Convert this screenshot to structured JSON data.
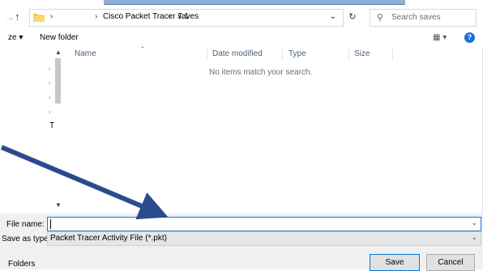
{
  "address_bar": {
    "path": [
      "Cisco Packet Tracer 7.1",
      "saves"
    ],
    "separator": "›"
  },
  "search": {
    "placeholder": "Search saves"
  },
  "toolbar": {
    "organize_label": "ze ▾",
    "new_folder_label": "New folder",
    "view_label": "▦ ▾",
    "help_label": "?"
  },
  "columns": [
    "Name",
    "Date modified",
    "Type",
    "Size"
  ],
  "file_list": {
    "empty_message": "No items match your search."
  },
  "nav_pane": {
    "partial_label": "T"
  },
  "form": {
    "file_name_label": "File name:",
    "file_name_value": "",
    "save_type_label": "Save as type:",
    "save_type_value": "Packet Tracer Activity File (*.pkt)"
  },
  "footer": {
    "folders_label": "Folders",
    "save_label": "Save",
    "cancel_label": "Cancel"
  },
  "colors": {
    "accent": "#1b77d2",
    "annotation_arrow": "#2a4b8d"
  }
}
